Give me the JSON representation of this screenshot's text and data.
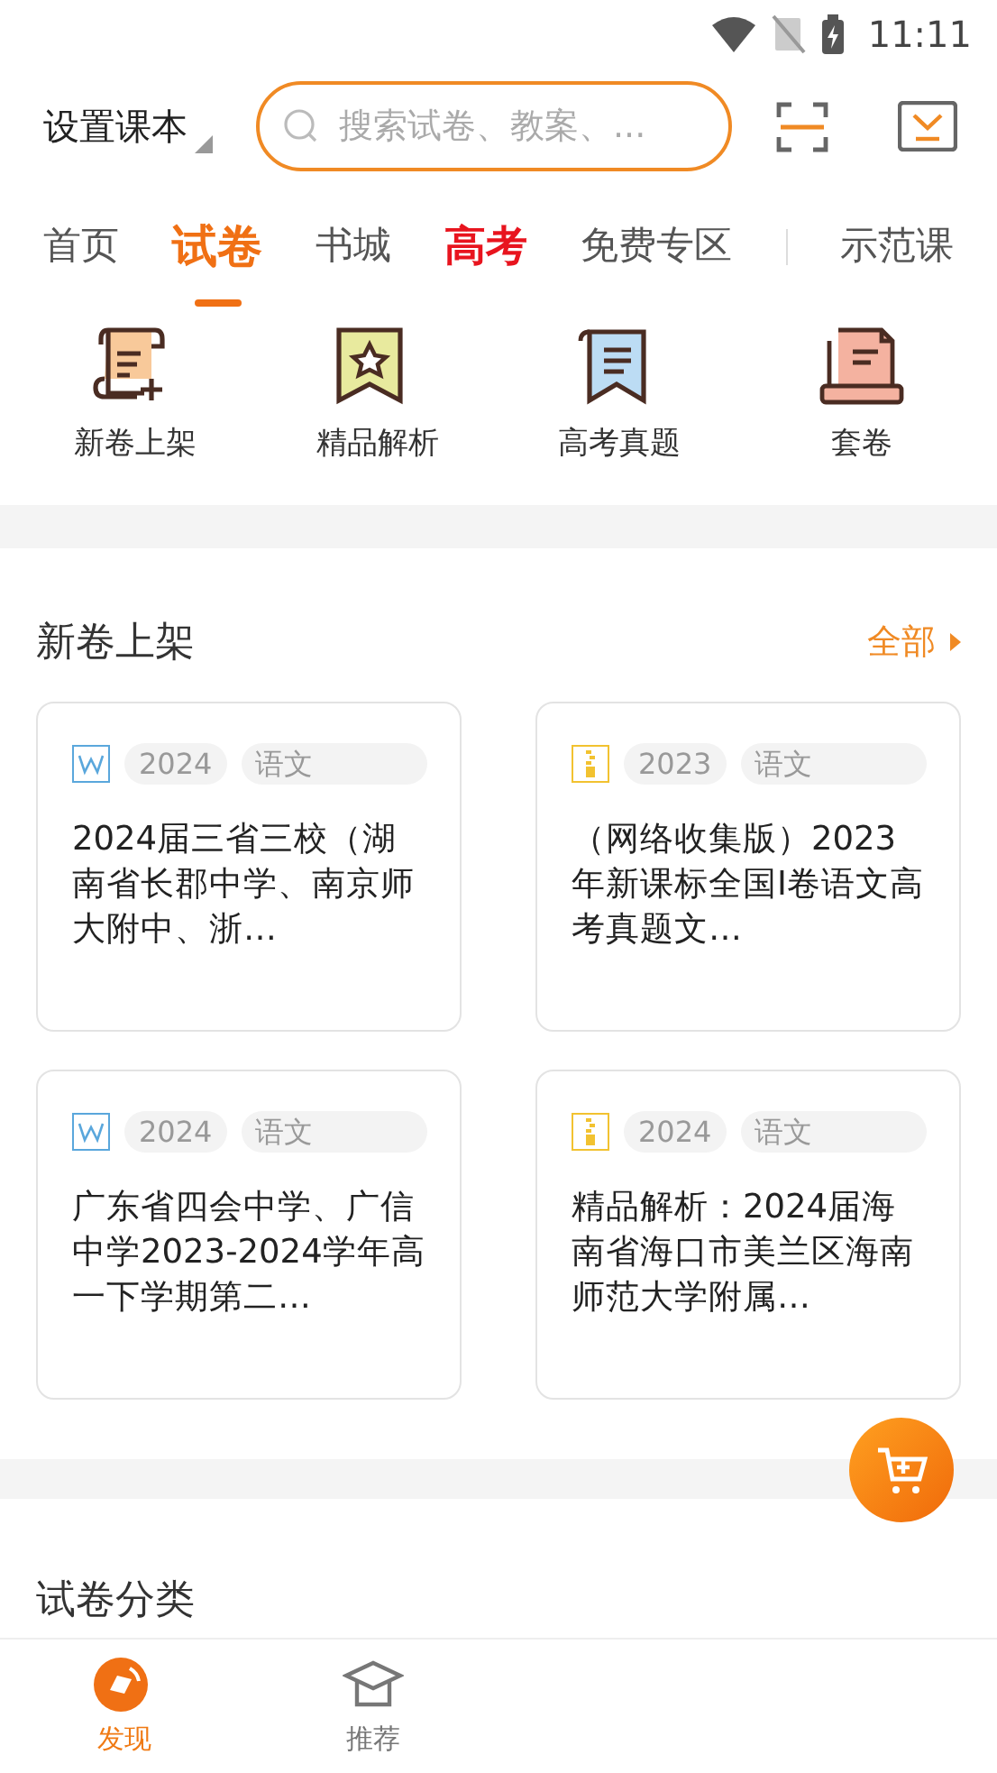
{
  "status_bar": {
    "time": "11:11"
  },
  "header": {
    "textbook_label": "设置课本",
    "search": {
      "placeholder": "搜索试卷、教案、..."
    }
  },
  "tabs": [
    {
      "label": "首页",
      "selected": false,
      "kind": "normal"
    },
    {
      "label": "试卷",
      "selected": true,
      "kind": "normal"
    },
    {
      "label": "书城",
      "selected": false,
      "kind": "normal"
    },
    {
      "label": "高考",
      "selected": false,
      "kind": "highlight"
    },
    {
      "label": "免费专区",
      "selected": false,
      "kind": "normal"
    },
    {
      "label": "示范课",
      "selected": false,
      "kind": "normal"
    }
  ],
  "shortcuts": [
    {
      "label": "新卷上架",
      "kind": "new"
    },
    {
      "label": "精品解析",
      "kind": "star"
    },
    {
      "label": "高考真题",
      "kind": "exam"
    },
    {
      "label": "套卷",
      "kind": "set"
    }
  ],
  "new_papers": {
    "title": "新卷上架",
    "more": "全部",
    "cards": [
      {
        "kind": "word",
        "year": "2024",
        "subject": "语文",
        "title": "2024届三省三校（湖南省长郡中学、南京师大附中、浙…"
      },
      {
        "kind": "zip",
        "year": "2023",
        "subject": "语文",
        "title": "（网络收集版）2023年新课标全国I卷语文高考真题文…"
      },
      {
        "kind": "word",
        "year": "2024",
        "subject": "语文",
        "title": "广东省四会中学、广信中学2023-2024学年高一下学期第二…"
      },
      {
        "kind": "zip",
        "year": "2024",
        "subject": "语文",
        "title": "精品解析：2024届海南省海口市美兰区海南师范大学附属…"
      }
    ]
  },
  "next_section": {
    "title": "试卷分类"
  },
  "bottom_nav": [
    {
      "label": "发现",
      "selected": true,
      "kind": "discover"
    },
    {
      "label": "推荐",
      "selected": false,
      "kind": "recommend"
    }
  ]
}
